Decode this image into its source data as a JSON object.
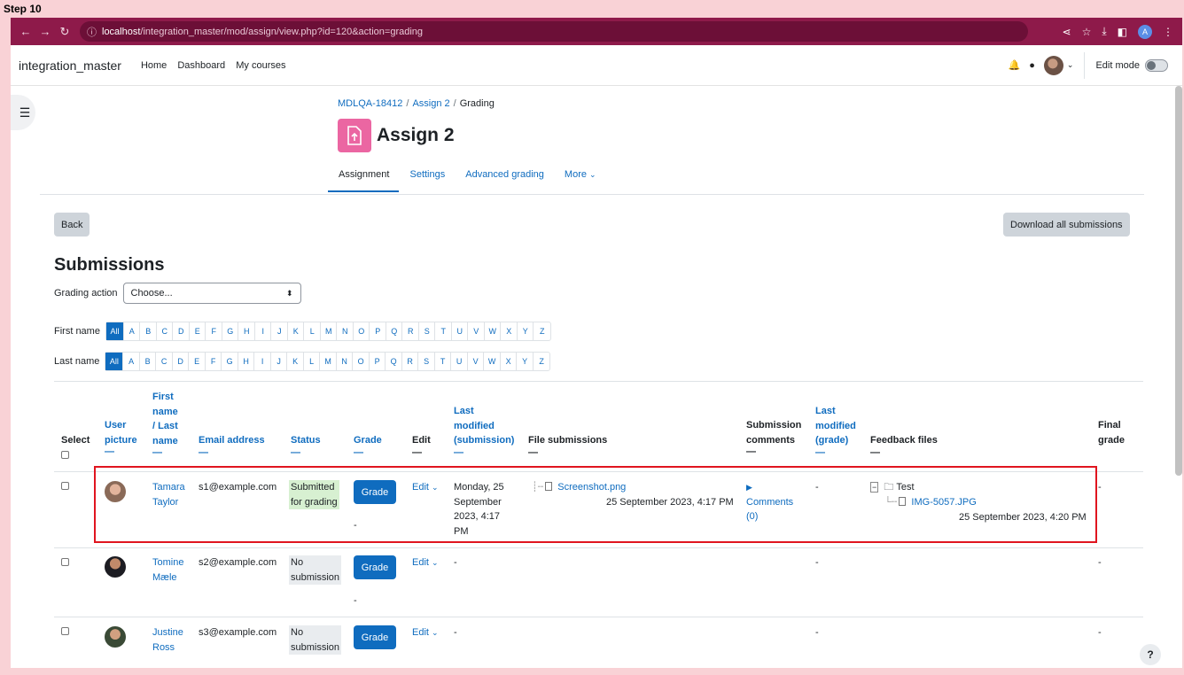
{
  "step": "Step 10",
  "browser": {
    "url_host": "localhost",
    "url_path": "/integration_master/mod/assign/view.php?id=120&action=grading",
    "profile_letter": "A"
  },
  "header": {
    "site_name": "integration_master",
    "nav": [
      "Home",
      "Dashboard",
      "My courses"
    ],
    "edit_mode": "Edit mode"
  },
  "breadcrumb": [
    "MDLQA-18412",
    "Assign 2",
    "Grading"
  ],
  "page_title": "Assign 2",
  "tabs": [
    "Assignment",
    "Settings",
    "Advanced grading",
    "More"
  ],
  "buttons": {
    "back": "Back",
    "download_all": "Download all submissions"
  },
  "section_title": "Submissions",
  "grading_action": {
    "label": "Grading action",
    "selected": "Choose..."
  },
  "filters": {
    "first_name_label": "First name",
    "last_name_label": "Last name",
    "letters": [
      "All",
      "A",
      "B",
      "C",
      "D",
      "E",
      "F",
      "G",
      "H",
      "I",
      "J",
      "K",
      "L",
      "M",
      "N",
      "O",
      "P",
      "Q",
      "R",
      "S",
      "T",
      "U",
      "V",
      "W",
      "X",
      "Y",
      "Z"
    ]
  },
  "table": {
    "headers": {
      "select": "Select",
      "user_picture": [
        "User",
        "picture"
      ],
      "name": [
        "First",
        "name",
        "/ Last",
        "name"
      ],
      "email": "Email address",
      "status": "Status",
      "grade": "Grade",
      "edit": "Edit",
      "last_modified_sub": [
        "Last",
        "modified",
        "(submission)"
      ],
      "file_submissions": "File submissions",
      "submission_comments": [
        "Submission",
        "comments"
      ],
      "last_modified_grade": [
        "Last",
        "modified",
        "(grade)"
      ],
      "feedback_files": "Feedback files",
      "final_grade": [
        "Final",
        "grade"
      ],
      "dash": "—"
    },
    "rows": [
      {
        "first": "Tamara",
        "last": "Taylor",
        "email": "s1@example.com",
        "status": [
          "Submitted",
          "for grading"
        ],
        "grade_btn": "Grade",
        "grade_val": "-",
        "edit": "Edit",
        "modified": [
          "Monday, 25",
          "September",
          "2023, 4:17",
          "PM"
        ],
        "file_name": "Screenshot.png",
        "file_date": "25 September 2023, 4:17 PM",
        "comments": [
          "Comments",
          "(0)"
        ],
        "grade_mod": "-",
        "feedback_folder": "Test",
        "feedback_file": "IMG-5057.JPG",
        "feedback_date": "25 September 2023, 4:20 PM",
        "final": "-"
      },
      {
        "first": "Tomine",
        "last": "Mæle",
        "email": "s2@example.com",
        "status": [
          "No",
          "submission"
        ],
        "grade_btn": "Grade",
        "grade_val": "-",
        "edit": "Edit",
        "modified_dash": "-",
        "grade_mod": "-",
        "final": "-"
      },
      {
        "first": "Justine",
        "last": "Ross",
        "email": "s3@example.com",
        "status": [
          "No",
          "submission"
        ],
        "grade_btn": "Grade",
        "edit": "Edit",
        "modified_dash": "-",
        "grade_mod": "-",
        "final": "-"
      }
    ]
  },
  "help": "?",
  "colors": {
    "brand": "#0f6cbf",
    "browser_bar": "#8e1a4a",
    "activity_icon": "#eb66a2",
    "highlight": "#e0151f"
  }
}
